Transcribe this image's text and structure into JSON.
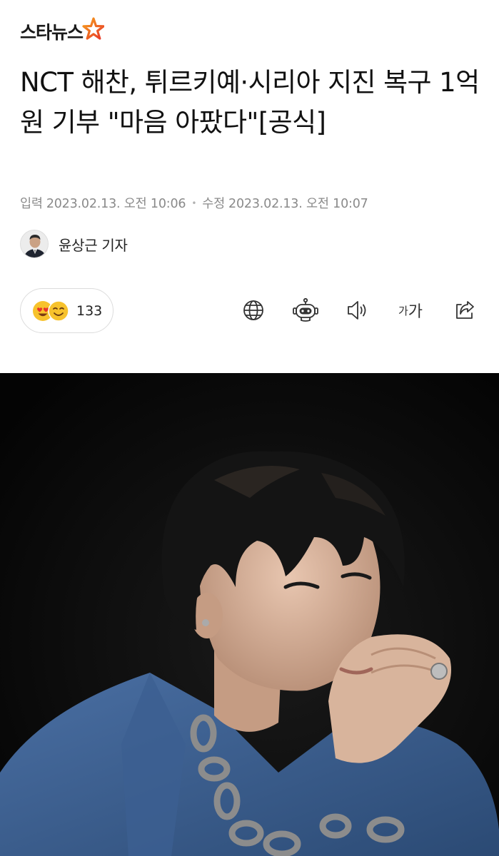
{
  "brand": {
    "logo_text": "스타뉴스"
  },
  "article": {
    "headline": "NCT 해찬, 튀르키예·시리아 지진 복구 1억원 기부 \"마음 아팠다\"[공식]",
    "input_label": "입력",
    "input_date": "2023.02.13. 오전 10:06",
    "modified_label": "수정",
    "modified_date": "2023.02.13. 오전 10:07",
    "reporter": "윤상근 기자"
  },
  "reactions": {
    "count": "133",
    "emojis": [
      "heart-eyes-emoji",
      "smile-emoji"
    ]
  },
  "toolbar": {
    "font_small": "가",
    "font_big": "가",
    "icons": [
      "globe-icon",
      "robot-icon",
      "speaker-icon",
      "font-size-icon",
      "share-icon"
    ]
  },
  "colors": {
    "logo_star_red": "#e8342a",
    "logo_star_orange": "#f6a31b",
    "date_gray": "#8a8a8a",
    "emoji_yellow": "#f7c22c",
    "photo_bg": "#050505",
    "jacket_blue": "#3a5d8f"
  }
}
